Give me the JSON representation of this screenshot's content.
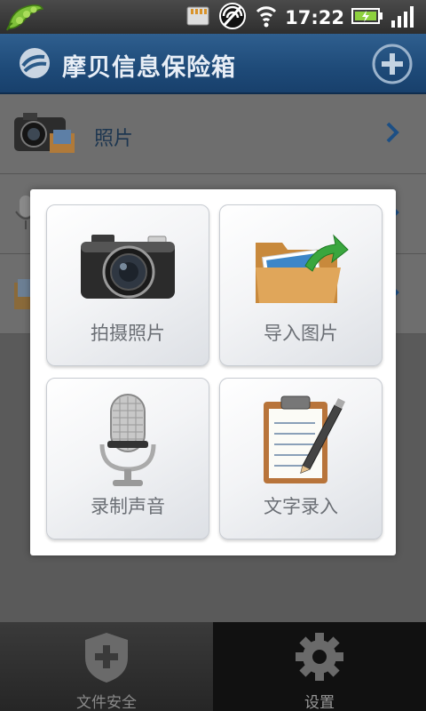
{
  "status_bar": {
    "time": "17:22",
    "icons": [
      "peapod-icon",
      "sd-card-icon",
      "usb-debug-icon",
      "wifi-icon",
      "battery-charging-icon",
      "signal-icon"
    ]
  },
  "header": {
    "title": "摩贝信息保险箱",
    "logo_icon": "app-logo-icon",
    "add_icon": "plus-circle-icon"
  },
  "list": {
    "items": [
      {
        "label": "照片",
        "icon": "camera-photo-icon"
      },
      {
        "label": "",
        "icon": "microphone-icon"
      },
      {
        "label": "",
        "icon": "folder-icon"
      }
    ]
  },
  "dialog": {
    "options": [
      {
        "label": "拍摄照片",
        "icon": "camera-icon"
      },
      {
        "label": "导入图片",
        "icon": "folder-import-icon"
      },
      {
        "label": "录制声音",
        "icon": "microphone-icon"
      },
      {
        "label": "文字录入",
        "icon": "clipboard-pen-icon"
      }
    ]
  },
  "bottom_tabs": [
    {
      "label": "文件安全",
      "icon": "shield-plus-icon"
    },
    {
      "label": "设置",
      "icon": "gear-icon"
    }
  ]
}
